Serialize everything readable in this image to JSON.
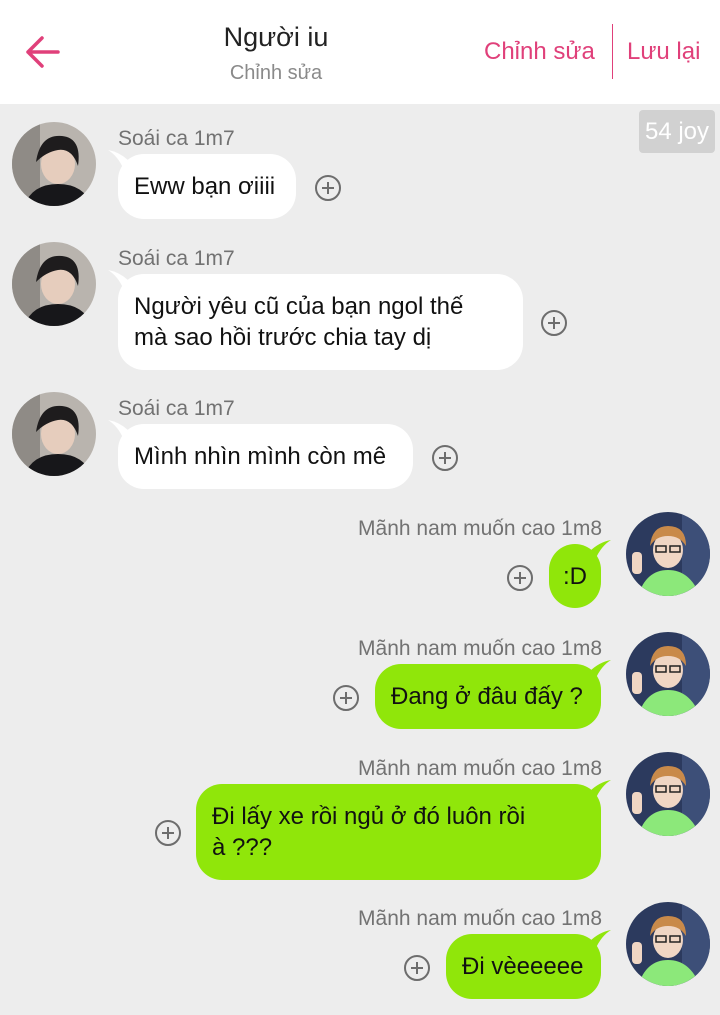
{
  "header": {
    "title": "Người iu",
    "subtitle": "Chỉnh sửa",
    "edit_label": "Chỉnh sửa",
    "save_label": "Lưu lại",
    "accent_color": "#e0407a"
  },
  "badge": {
    "text": "54 joy"
  },
  "messages": [
    {
      "side": "left",
      "sender": "Soái ca 1m7",
      "text": "Eww bạn ơiiii",
      "bubble_color": "#ffffff"
    },
    {
      "side": "left",
      "sender": "Soái ca 1m7",
      "text": "Người yêu cũ của bạn ngol thế\nmà sao hồi trước chia tay dị",
      "bubble_color": "#ffffff"
    },
    {
      "side": "left",
      "sender": "Soái ca 1m7",
      "text": "Mình nhìn mình còn mê",
      "bubble_color": "#ffffff"
    },
    {
      "side": "right",
      "sender": "Mãnh nam muốn cao 1m8",
      "text": ":D",
      "bubble_color": "#90e60a"
    },
    {
      "side": "right",
      "sender": "Mãnh nam muốn cao 1m8",
      "text": "Đang ở đâu đấy ?",
      "bubble_color": "#90e60a"
    },
    {
      "side": "right",
      "sender": "Mãnh nam muốn cao 1m8",
      "text": "Đi lấy xe rồi ngủ ở đó luôn rồi\nà ???",
      "bubble_color": "#90e60a"
    },
    {
      "side": "right",
      "sender": "Mãnh nam muốn cao 1m8",
      "text": "Đi vèeeeee",
      "bubble_color": "#90e60a"
    }
  ],
  "icons": {
    "back": "arrow-left-icon",
    "add": "plus-circle-icon"
  }
}
